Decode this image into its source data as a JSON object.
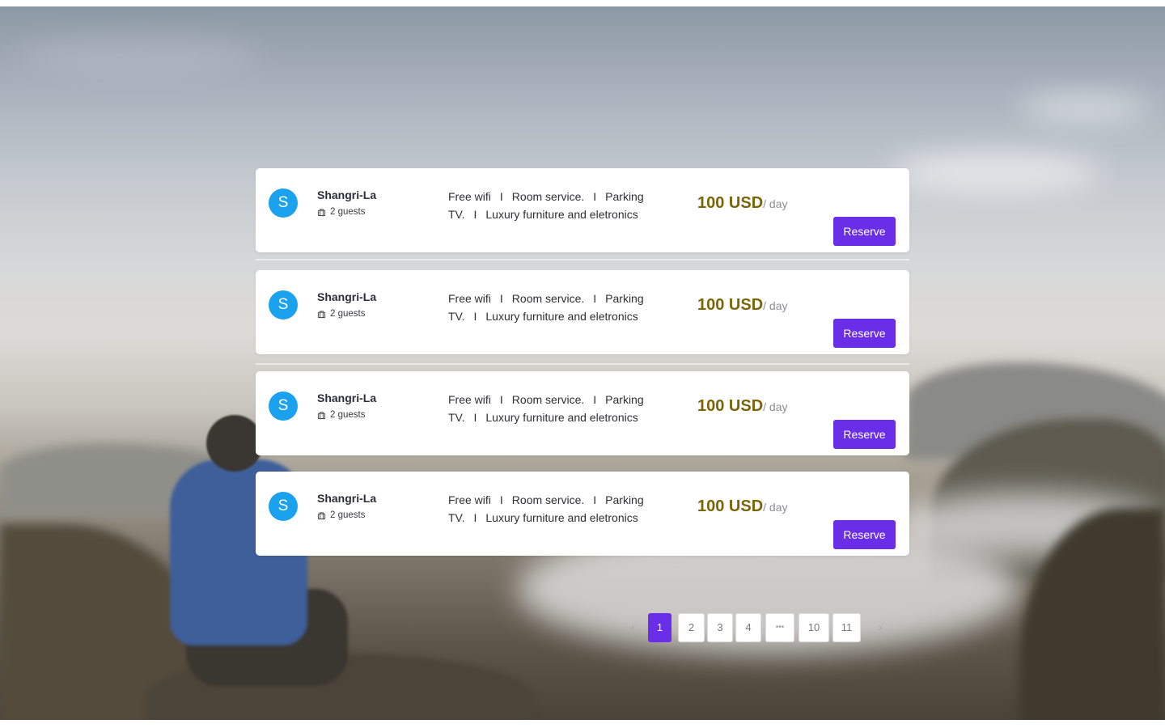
{
  "listings": [
    {
      "avatar_letter": "S",
      "name": "Shangri-La",
      "guests": "2 guests",
      "amenities_line1": [
        "Free wifi",
        "Room service.",
        "Parking"
      ],
      "amenities_line2": [
        "TV.",
        "Luxury furniture and eletronics"
      ],
      "separator": "I",
      "price": "100 USD",
      "price_unit": "/ day",
      "reserve_label": "Reserve"
    },
    {
      "avatar_letter": "S",
      "name": "Shangri-La",
      "guests": "2 guests",
      "amenities_line1": [
        "Free wifi",
        "Room service.",
        "Parking"
      ],
      "amenities_line2": [
        "TV.",
        "Luxury furniture and eletronics"
      ],
      "separator": "I",
      "price": "100 USD",
      "price_unit": "/ day",
      "reserve_label": "Reserve"
    },
    {
      "avatar_letter": "S",
      "name": "Shangri-La",
      "guests": "2 guests",
      "amenities_line1": [
        "Free wifi",
        "Room service.",
        "Parking"
      ],
      "amenities_line2": [
        "TV.",
        "Luxury furniture and eletronics"
      ],
      "separator": "I",
      "price": "100 USD",
      "price_unit": "/ day",
      "reserve_label": "Reserve"
    },
    {
      "avatar_letter": "S",
      "name": "Shangri-La",
      "guests": "2 guests",
      "amenities_line1": [
        "Free wifi",
        "Room service.",
        "Parking"
      ],
      "amenities_line2": [
        "TV.",
        "Luxury furniture and eletronics"
      ],
      "separator": "I",
      "price": "100 USD",
      "price_unit": "/ day",
      "reserve_label": "Reserve"
    }
  ],
  "pagination": {
    "prev_icon": "chevron-left-icon",
    "next_icon": "chevron-right-icon",
    "pages": [
      "1",
      "2",
      "3",
      "4",
      "•••",
      "10",
      "11"
    ],
    "current": "1"
  },
  "colors": {
    "accent": "#6b2ee8",
    "avatar": "#1ba2ee",
    "price": "#7b6507"
  }
}
